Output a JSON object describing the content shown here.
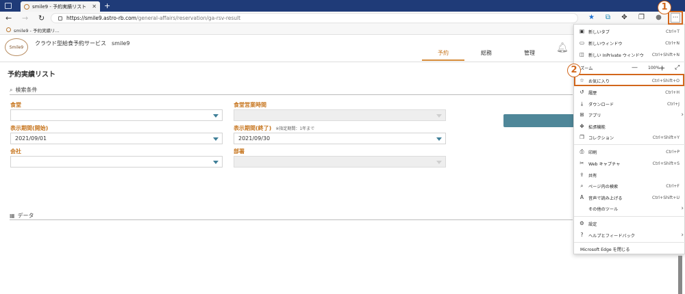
{
  "browser": {
    "tab_title": "smile9 - 予約実績リスト",
    "new_tab": "+",
    "url_domain": "https://smile9.astro-rb.com",
    "url_path": "/general-affairs/reservation/ga-rsv-result",
    "bookmark": "smile9 - 予約実績リ..."
  },
  "app": {
    "logo_text": "Smile9",
    "service_title": "クラウド型給食予約サービス　smile9",
    "menu": [
      "予約",
      "総務",
      "管理"
    ]
  },
  "page": {
    "title": "予約実績リスト",
    "search_section": "検索条件",
    "data_section": "データ",
    "fields": {
      "cafeteria_label": "食堂",
      "hours_label": "食堂営業時間",
      "period_start_label": "表示期間(開始)",
      "period_start_value": "2021/09/01",
      "period_end_label": "表示期間(終了)",
      "period_end_note": "※指定期間：1年まで",
      "period_end_value": "2021/09/30",
      "company_label": "会社",
      "department_label": "部署"
    }
  },
  "context_menu": {
    "items": [
      {
        "label": "新しいタブ",
        "shortcut": "Ctrl+T",
        "icon": "new-tab-icon"
      },
      {
        "label": "新しいウィンドウ",
        "shortcut": "Ctrl+N",
        "icon": "new-window-icon"
      },
      {
        "label": "新しい InPrivate ウィンドウ",
        "shortcut": "Ctrl+Shift+N",
        "icon": "inprivate-icon"
      }
    ],
    "zoom": {
      "label": "ズーム",
      "minus": "—",
      "value": "100%",
      "plus": "+"
    },
    "items2": [
      {
        "label": "お気に入り",
        "shortcut": "Ctrl+Shift+O",
        "icon": "favorites-icon"
      },
      {
        "label": "履歴",
        "shortcut": "Ctrl+H",
        "icon": "history-icon"
      },
      {
        "label": "ダウンロード",
        "shortcut": "Ctrl+J",
        "icon": "download-icon"
      },
      {
        "label": "アプリ",
        "shortcut": "",
        "icon": "apps-icon"
      },
      {
        "label": "拡張機能",
        "shortcut": "",
        "icon": "extensions-icon"
      },
      {
        "label": "コレクション",
        "shortcut": "Ctrl+Shift+Y",
        "icon": "collections-icon"
      }
    ],
    "items3": [
      {
        "label": "印刷",
        "shortcut": "Ctrl+P",
        "icon": "print-icon"
      },
      {
        "label": "Web キャプチャ",
        "shortcut": "Ctrl+Shift+S",
        "icon": "web-capture-icon"
      },
      {
        "label": "共有",
        "shortcut": "",
        "icon": "share-icon"
      },
      {
        "label": "ページ内の検索",
        "shortcut": "Ctrl+F",
        "icon": "find-icon"
      },
      {
        "label": "音声で読み上げる",
        "shortcut": "Ctrl+Shift+U",
        "icon": "read-aloud-icon"
      },
      {
        "label": "その他のツール",
        "shortcut": "",
        "icon": ""
      }
    ],
    "items4": [
      {
        "label": "設定",
        "shortcut": "",
        "icon": "settings-icon"
      },
      {
        "label": "ヘルプとフィードバック",
        "shortcut": "",
        "icon": "help-icon"
      }
    ],
    "close_label": "Microsoft Edge を閉じる"
  },
  "annotations": {
    "step1": "1",
    "step2": "2",
    "color": "#d2661a"
  }
}
